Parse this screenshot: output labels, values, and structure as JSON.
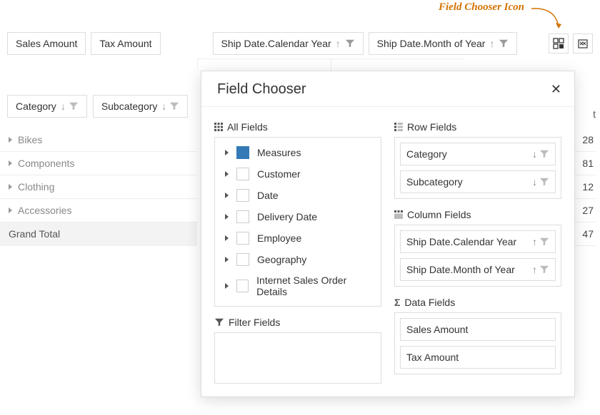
{
  "annotation": "Field Chooser Icon",
  "toolbar": {
    "data_fields": [
      "Sales Amount",
      "Tax Amount"
    ],
    "col_fields": [
      "Ship Date.Calendar Year",
      "Ship Date.Month of Year"
    ]
  },
  "row_area": {
    "fields": [
      "Category",
      "Subcategory"
    ]
  },
  "rows": [
    "Bikes",
    "Components",
    "Clothing",
    "Accessories"
  ],
  "grand_total": "Grand Total",
  "partial_header_suffix": "t",
  "values": [
    "28",
    "81",
    "12",
    "27",
    "47"
  ],
  "modal": {
    "title": "Field Chooser",
    "all_fields_label": "All Fields",
    "tree": [
      {
        "label": "Measures",
        "checked": true
      },
      {
        "label": "Customer",
        "checked": false
      },
      {
        "label": "Date",
        "checked": false
      },
      {
        "label": "Delivery Date",
        "checked": false
      },
      {
        "label": "Employee",
        "checked": false
      },
      {
        "label": "Geography",
        "checked": false
      },
      {
        "label": "Internet Sales Order Details",
        "checked": false
      }
    ],
    "filter_fields_label": "Filter Fields",
    "row_fields_label": "Row Fields",
    "row_fields": [
      {
        "label": "Category",
        "sort": "down"
      },
      {
        "label": "Subcategory",
        "sort": "down"
      }
    ],
    "column_fields_label": "Column Fields",
    "column_fields": [
      {
        "label": "Ship Date.Calendar Year",
        "sort": "up"
      },
      {
        "label": "Ship Date.Month of Year",
        "sort": "up"
      }
    ],
    "data_fields_label": "Data Fields",
    "data_fields": [
      {
        "label": "Sales Amount"
      },
      {
        "label": "Tax Amount"
      }
    ]
  }
}
